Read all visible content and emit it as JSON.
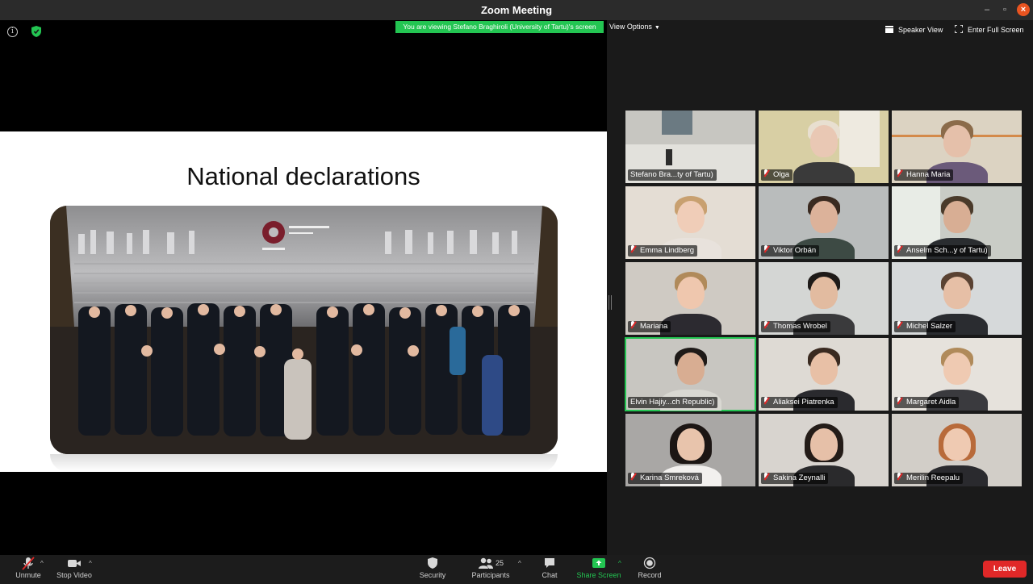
{
  "window": {
    "title": "Zoom Meeting"
  },
  "share": {
    "banner": "You are viewing Stefano Braghiroli (University of Tartu)'s screen",
    "view_options": "View Options",
    "slide_title": "National declarations"
  },
  "view_controls": {
    "speaker_view": "Speaker View",
    "full_screen": "Enter Full Screen"
  },
  "participants": [
    {
      "name": "Stefano Bra...ty of Tartu)",
      "muted": false
    },
    {
      "name": "Olga",
      "muted": true
    },
    {
      "name": "Hanna Maria",
      "muted": true
    },
    {
      "name": "Emma Lindberg",
      "muted": true
    },
    {
      "name": "Viktor Orbán",
      "muted": true
    },
    {
      "name": "Anselm Sch...y of Tartu)",
      "muted": true
    },
    {
      "name": "Mariana",
      "muted": true
    },
    {
      "name": "Thomas Wrobel",
      "muted": true
    },
    {
      "name": "Michel Salzer",
      "muted": true
    },
    {
      "name": "Elvin Hajiy...ch Republic)",
      "muted": false,
      "active_speaker": true
    },
    {
      "name": "Aliaksei Piatrenka",
      "muted": true
    },
    {
      "name": "Margaret Aidla",
      "muted": true
    },
    {
      "name": "Karina Smreková",
      "muted": true
    },
    {
      "name": "Sakina Zeynalli",
      "muted": true
    },
    {
      "name": "Merilin Reepalu",
      "muted": true
    }
  ],
  "toolbar": {
    "unmute": "Unmute",
    "stop_video": "Stop Video",
    "security": "Security",
    "participants": "Participants",
    "participants_count": "25",
    "chat": "Chat",
    "share_screen": "Share Screen",
    "record": "Record",
    "leave": "Leave"
  },
  "colors": {
    "accent_green": "#23c552",
    "leave_red": "#e02828",
    "titlebar": "#2b2b2b"
  },
  "icons": [
    "info-icon",
    "shield-icon",
    "chevron-down-icon",
    "speaker-view-icon",
    "fullscreen-icon",
    "mic-muted-icon",
    "video-icon",
    "security-icon",
    "participants-icon",
    "chat-icon",
    "share-screen-icon",
    "record-icon"
  ]
}
